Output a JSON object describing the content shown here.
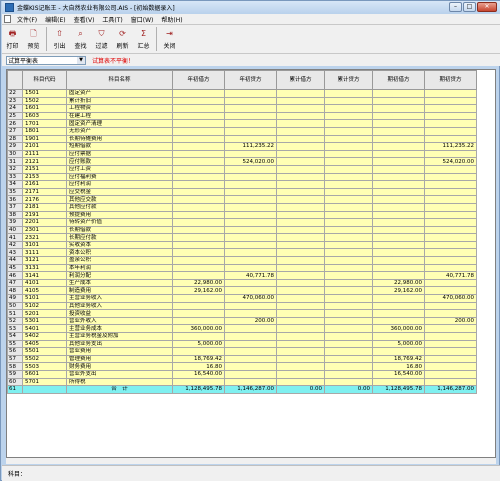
{
  "window": {
    "title": "金蝶KIS记账王 - 大自然农业有限公司.AIS - [初始数据录入]",
    "min": "–",
    "max": "□",
    "close": "✕"
  },
  "menu": [
    "文件(F)",
    "编辑(E)",
    "查看(V)",
    "工具(T)",
    "窗口(W)",
    "帮助(H)"
  ],
  "toolbar": [
    {
      "label": "打印",
      "icon": "printer-icon",
      "glyph": "🖶"
    },
    {
      "label": "预览",
      "icon": "preview-icon",
      "glyph": "🗋"
    },
    {
      "label": "引出",
      "icon": "export-icon",
      "glyph": "⇧"
    },
    {
      "label": "查找",
      "icon": "find-icon",
      "glyph": "⌕"
    },
    {
      "label": "过滤",
      "icon": "filter-icon",
      "glyph": "⛉"
    },
    {
      "label": "刷新",
      "icon": "refresh-icon",
      "glyph": "⟳"
    },
    {
      "label": "汇总",
      "icon": "summary-icon",
      "glyph": "Σ"
    },
    {
      "label": "关闭",
      "icon": "close-door-icon",
      "glyph": "⇥"
    }
  ],
  "filter": {
    "selected": "试算平衡表",
    "warning": "试算表不平衡！"
  },
  "table": {
    "columns": [
      "科目代码",
      "科目名称",
      "年初借方",
      "年初贷方",
      "累计借方",
      "累计贷方",
      "期初借方",
      "期初贷方"
    ],
    "rows": [
      [
        "22",
        "1501",
        "固定资产",
        "",
        "",
        "",
        "",
        "",
        ""
      ],
      [
        "23",
        "1502",
        "累计折旧",
        "",
        "",
        "",
        "",
        "",
        ""
      ],
      [
        "24",
        "1601",
        "工程物资",
        "",
        "",
        "",
        "",
        "",
        ""
      ],
      [
        "25",
        "1603",
        "在建工程",
        "",
        "",
        "",
        "",
        "",
        ""
      ],
      [
        "26",
        "1701",
        "固定资产清理",
        "",
        "",
        "",
        "",
        "",
        ""
      ],
      [
        "27",
        "1801",
        "无形资产",
        "",
        "",
        "",
        "",
        "",
        ""
      ],
      [
        "28",
        "1901",
        "长期待摊费用",
        "",
        "",
        "",
        "",
        "",
        ""
      ],
      [
        "29",
        "2101",
        "短期借款",
        "",
        "111,235.22",
        "",
        "",
        "",
        "111,235.22"
      ],
      [
        "30",
        "2111",
        "应付票据",
        "",
        "",
        "",
        "",
        "",
        ""
      ],
      [
        "31",
        "2121",
        "应付账款",
        "",
        "524,020.00",
        "",
        "",
        "",
        "524,020.00"
      ],
      [
        "32",
        "2151",
        "应付工资",
        "",
        "",
        "",
        "",
        "",
        ""
      ],
      [
        "33",
        "2153",
        "应付福利费",
        "",
        "",
        "",
        "",
        "",
        ""
      ],
      [
        "34",
        "2161",
        "应付利润",
        "",
        "",
        "",
        "",
        "",
        ""
      ],
      [
        "35",
        "2171",
        "应交税金",
        "",
        "",
        "",
        "",
        "",
        ""
      ],
      [
        "36",
        "2176",
        "其他应交款",
        "",
        "",
        "",
        "",
        "",
        ""
      ],
      [
        "37",
        "2181",
        "其他应付款",
        "",
        "",
        "",
        "",
        "",
        ""
      ],
      [
        "38",
        "2191",
        "预提费用",
        "",
        "",
        "",
        "",
        "",
        ""
      ],
      [
        "39",
        "2201",
        "待转资产价值",
        "",
        "",
        "",
        "",
        "",
        ""
      ],
      [
        "40",
        "2301",
        "长期借款",
        "",
        "",
        "",
        "",
        "",
        ""
      ],
      [
        "41",
        "2321",
        "长期应付款",
        "",
        "",
        "",
        "",
        "",
        ""
      ],
      [
        "42",
        "3101",
        "实收资本",
        "",
        "",
        "",
        "",
        "",
        ""
      ],
      [
        "43",
        "3111",
        "资本公积",
        "",
        "",
        "",
        "",
        "",
        ""
      ],
      [
        "44",
        "3121",
        "盈余公积",
        "",
        "",
        "",
        "",
        "",
        ""
      ],
      [
        "45",
        "3131",
        "本年利润",
        "",
        "",
        "",
        "",
        "",
        ""
      ],
      [
        "46",
        "3141",
        "利润分配",
        "",
        "40,771.78",
        "",
        "",
        "",
        "40,771.78"
      ],
      [
        "47",
        "4101",
        "生产成本",
        "22,980.00",
        "",
        "",
        "",
        "22,980.00",
        ""
      ],
      [
        "48",
        "4105",
        "制造费用",
        "29,162.00",
        "",
        "",
        "",
        "29,162.00",
        ""
      ],
      [
        "49",
        "5101",
        "主营业务收入",
        "",
        "470,060.00",
        "",
        "",
        "",
        "470,060.00"
      ],
      [
        "50",
        "5102",
        "其他业务收入",
        "",
        "",
        "",
        "",
        "",
        ""
      ],
      [
        "51",
        "5201",
        "投资收益",
        "",
        "",
        "",
        "",
        "",
        ""
      ],
      [
        "52",
        "5301",
        "营业外收入",
        "",
        "200.00",
        "",
        "",
        "",
        "200.00"
      ],
      [
        "53",
        "5401",
        "主营业务成本",
        "360,000.00",
        "",
        "",
        "",
        "360,000.00",
        ""
      ],
      [
        "54",
        "5402",
        "主营业务税金及附加",
        "",
        "",
        "",
        "",
        "",
        ""
      ],
      [
        "55",
        "5405",
        "其他业务支出",
        "5,000.00",
        "",
        "",
        "",
        "5,000.00",
        ""
      ],
      [
        "56",
        "5501",
        "营业费用",
        "",
        "",
        "",
        "",
        "",
        ""
      ],
      [
        "57",
        "5502",
        "管理费用",
        "18,769.42",
        "",
        "",
        "",
        "18,769.42",
        ""
      ],
      [
        "58",
        "5503",
        "财务费用",
        "16.80",
        "",
        "",
        "",
        "16.80",
        ""
      ],
      [
        "59",
        "5601",
        "营业外支出",
        "16,540.00",
        "",
        "",
        "",
        "16,540.00",
        ""
      ],
      [
        "60",
        "5701",
        "所得税",
        "",
        "",
        "",
        "",
        "",
        ""
      ]
    ],
    "total": [
      "61",
      "",
      "合　计",
      "1,128,495.78",
      "1,146,287.00",
      "0.00",
      "0.00",
      "1,128,495.78",
      "1,146,287.00"
    ]
  },
  "status": {
    "label": "科目："
  }
}
